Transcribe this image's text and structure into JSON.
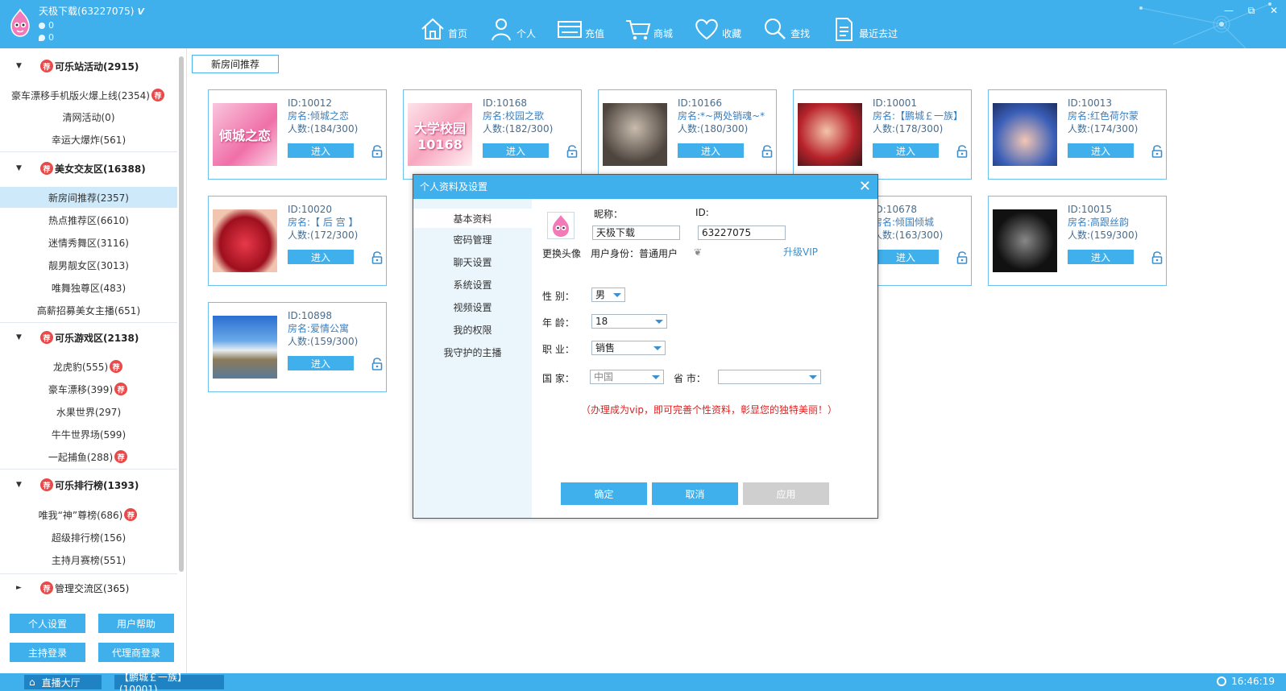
{
  "header": {
    "username": "天极下载",
    "user_id": "(63227075)",
    "vip_mark": "V",
    "coins": "0",
    "flowers": "0",
    "nav": [
      {
        "label": "首页",
        "icon": "home-icon"
      },
      {
        "label": "个人",
        "icon": "user-icon"
      },
      {
        "label": "充值",
        "icon": "card-icon"
      },
      {
        "label": "商城",
        "icon": "cart-icon"
      },
      {
        "label": "收藏",
        "icon": "heart-icon"
      },
      {
        "label": "查找",
        "icon": "search-icon"
      },
      {
        "label": "最近去过",
        "icon": "history-icon"
      }
    ],
    "window_controls": [
      "—",
      "⧉",
      "✕"
    ]
  },
  "sidebar": {
    "badge_text": "荐",
    "categories": [
      {
        "label": "可乐站活动(2915)",
        "expanded": true,
        "items": [
          {
            "label": "豪车漂移手机版火爆上线(2354)",
            "badge": true
          },
          {
            "label": "清网活动(0)",
            "badge": false
          },
          {
            "label": "幸运大爆炸(561)",
            "badge": false
          }
        ]
      },
      {
        "label": "美女交友区(16388)",
        "expanded": true,
        "items": [
          {
            "label": "新房间推荐(2357)",
            "badge": false,
            "active": true
          },
          {
            "label": "热点推荐区(6610)",
            "badge": false
          },
          {
            "label": "迷情秀舞区(3116)",
            "badge": false
          },
          {
            "label": "靓男靓女区(3013)",
            "badge": false
          },
          {
            "label": "唯舞独尊区(483)",
            "badge": false
          },
          {
            "label": "高薪招募美女主播(651)",
            "badge": false
          }
        ]
      },
      {
        "label": "可乐游戏区(2138)",
        "expanded": true,
        "items": [
          {
            "label": "龙虎豹(555)",
            "badge": true
          },
          {
            "label": "豪车漂移(399)",
            "badge": true
          },
          {
            "label": "水果世界(297)",
            "badge": false
          },
          {
            "label": "牛牛世界场(599)",
            "badge": false
          },
          {
            "label": "一起捕鱼(288)",
            "badge": true
          }
        ]
      },
      {
        "label": "可乐排行榜(1393)",
        "expanded": true,
        "items": [
          {
            "label": "唯我“神”尊榜(686)",
            "badge": true
          },
          {
            "label": "超级排行榜(156)",
            "badge": false
          },
          {
            "label": "主持月赛榜(551)",
            "badge": false
          }
        ]
      },
      {
        "label": "管理交流区(365)",
        "expanded": false,
        "items": []
      }
    ],
    "buttons": [
      "个人设置",
      "用户帮助",
      "主持登录",
      "代理商登录"
    ]
  },
  "main": {
    "tab": "新房间推荐",
    "enter_label": "进入",
    "rooms": [
      {
        "id": "ID:10012",
        "name": "房名:倾城之恋",
        "count": "人数:(184/300)",
        "thumb_text": "倾城之恋",
        "theme": "pink"
      },
      {
        "id": "ID:10168",
        "name": "房名:校园之歌",
        "count": "人数:(182/300)",
        "thumb_text": "大学校园 10168",
        "theme": "campus"
      },
      {
        "id": "ID:10166",
        "name": "房名:*~两处销魂~*",
        "count": "人数:(180/300)",
        "thumb_text": "",
        "theme": "dark"
      },
      {
        "id": "ID:10001",
        "name": "房名:【鹏城￡一族】",
        "count": "人数:(178/300)",
        "thumb_text": "",
        "theme": "red"
      },
      {
        "id": "ID:10013",
        "name": "房名:红色荷尔蒙",
        "count": "人数:(174/300)",
        "thumb_text": "",
        "theme": "blue"
      },
      {
        "id": "ID:10020",
        "name": "房名:【 后 宫 】",
        "count": "人数:(172/300)",
        "thumb_text": "",
        "theme": "lips"
      },
      {
        "id": "",
        "name": "",
        "count": "",
        "thumb_text": "",
        "theme": "hidden"
      },
      {
        "id": "",
        "name": "",
        "count": "",
        "thumb_text": "",
        "theme": "hidden"
      },
      {
        "id": "ID:10678",
        "name": "房名:倾国倾城",
        "count": "人数:(163/300)",
        "thumb_text": "",
        "theme": "hidden"
      },
      {
        "id": "ID:10015",
        "name": "房名:高跟丝韵",
        "count": "人数:(159/300)",
        "thumb_text": "",
        "theme": "bw"
      },
      {
        "id": "ID:10898",
        "name": "房名:爱情公寓",
        "count": "人数:(159/300)",
        "thumb_text": "",
        "theme": "landscape"
      }
    ]
  },
  "dialog": {
    "title": "个人资料及设置",
    "close": "✕",
    "menu": [
      "基本资料",
      "密码管理",
      "聊天设置",
      "系统设置",
      "视频设置",
      "我的权限",
      "我守护的主播"
    ],
    "change_avatar": "更换头像",
    "nickname_label": "昵称：",
    "nickname_value": "天极下载",
    "id_label": "ID:",
    "id_value": "63227075",
    "identity": "用户身份：普通用户",
    "upgrade": "升级VIP",
    "gender_label": "性  别：",
    "gender_value": "男",
    "age_label": "年  龄：",
    "age_value": "18",
    "job_label": "职  业：",
    "job_value": "销售",
    "country_label": "国  家：",
    "country_value": "中国",
    "province_label": "省  市：",
    "province_value": "",
    "vip_notice": "（办理成为vip，即可完善个性资料，彰显您的独特美丽！）",
    "notice_color": "#e02020",
    "buttons": {
      "ok": "确定",
      "cancel": "取消",
      "apply": "应用"
    }
  },
  "statusbar": {
    "lobby": "直播大厅",
    "room_tab": "【鹏城￡一族】(10001)",
    "time": "16:46:19"
  },
  "colors": {
    "accent": "#3fb0ec",
    "badge": "#e84a4a"
  }
}
